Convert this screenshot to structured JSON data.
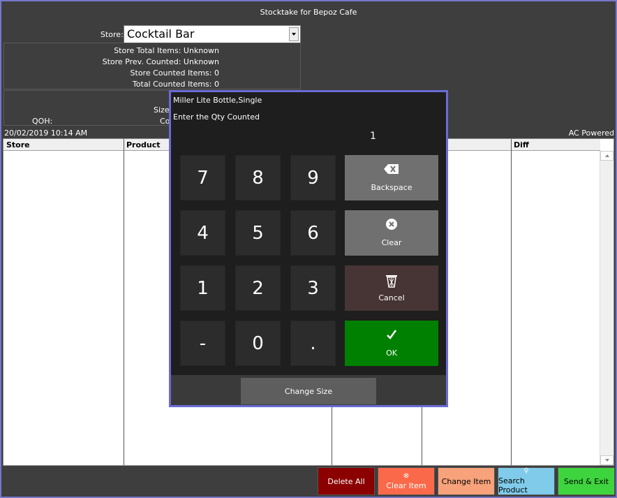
{
  "app": {
    "title": "Stocktake for Bepoz Cafe"
  },
  "store": {
    "label": "Store:",
    "selected": "Cocktail Bar"
  },
  "info": {
    "total_items": "Store Total Items: Unknown",
    "prev_counted": "Store Prev. Counted: Unknown",
    "counted_items": "Store Counted Items: 0",
    "total_counted": "Total Counted Items: 0",
    "size_label": "Size:",
    "qoh_label": "QOH:",
    "co_label": "Co"
  },
  "status": {
    "datetime": "20/02/2019 10:14 AM",
    "power": "AC Powered"
  },
  "grid": {
    "columns": [
      "Store",
      "Product",
      "Diff"
    ]
  },
  "dialog": {
    "item": "Miller Lite Bottle,Single",
    "prompt": "Enter the Qty Counted",
    "value": "1",
    "keys": [
      "7",
      "8",
      "9",
      "4",
      "5",
      "6",
      "1",
      "2",
      "3",
      "-",
      "0",
      "."
    ],
    "backspace_label": "Backspace",
    "clear_label": "Clear",
    "cancel_label": "Cancel",
    "ok_label": "OK",
    "change_size_label": "Change Size"
  },
  "toolbar": {
    "delete_all": "Delete All",
    "clear_item": "Clear Item",
    "change_item": "Change Item",
    "search_product": "Search Product",
    "send_exit": "Send & Exit"
  },
  "colors": {
    "frame": "#7777cc",
    "background": "#3e3e3e",
    "ok": "#008000",
    "cancel": "#473434",
    "delete_all": "#8b0000",
    "clear_item": "#fa6a4a",
    "change_item": "#f7a27a",
    "search_product": "#7fcbe9",
    "send_exit": "#3ed43e"
  }
}
